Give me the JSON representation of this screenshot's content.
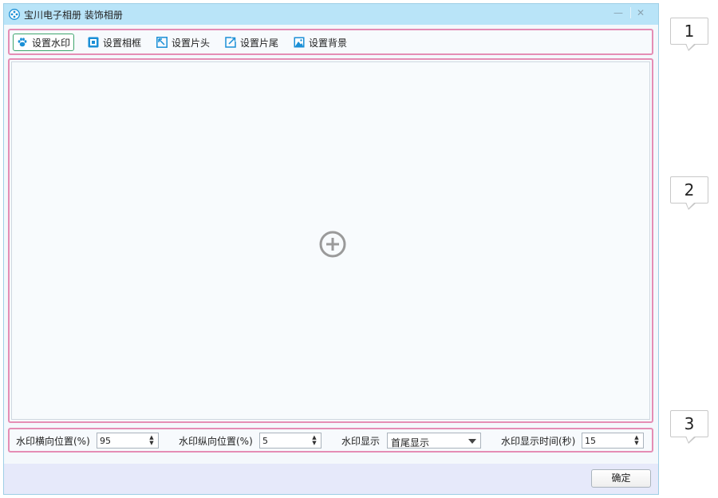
{
  "window": {
    "title": "宝川电子相册  装饰相册",
    "minimize_glyph": "—",
    "close_glyph": "✕"
  },
  "toolbar": {
    "items": [
      {
        "label": "设置水印",
        "icon": "paw-icon",
        "active": true
      },
      {
        "label": "设置相框",
        "icon": "frame-icon",
        "active": false
      },
      {
        "label": "设置片头",
        "icon": "intro-icon",
        "active": false
      },
      {
        "label": "设置片尾",
        "icon": "outro-icon",
        "active": false
      },
      {
        "label": "设置背景",
        "icon": "background-icon",
        "active": false
      }
    ]
  },
  "canvas": {
    "add_icon": "plus-circle-icon"
  },
  "params": {
    "h_pos_label": "水印横向位置(%)",
    "h_pos_value": "95",
    "v_pos_label": "水印纵向位置(%)",
    "v_pos_value": "5",
    "display_label": "水印显示",
    "display_value": "首尾显示",
    "duration_label": "水印显示时间(秒)",
    "duration_value": "15"
  },
  "footer": {
    "ok_label": "确定"
  },
  "callouts": [
    "1",
    "2",
    "3"
  ],
  "colors": {
    "titlebar": "#b9e4f8",
    "highlight_border": "#e58db5",
    "active_border": "#3fa56e",
    "icon_blue": "#1a8fd6",
    "footer_bg": "#e6e9fa"
  }
}
